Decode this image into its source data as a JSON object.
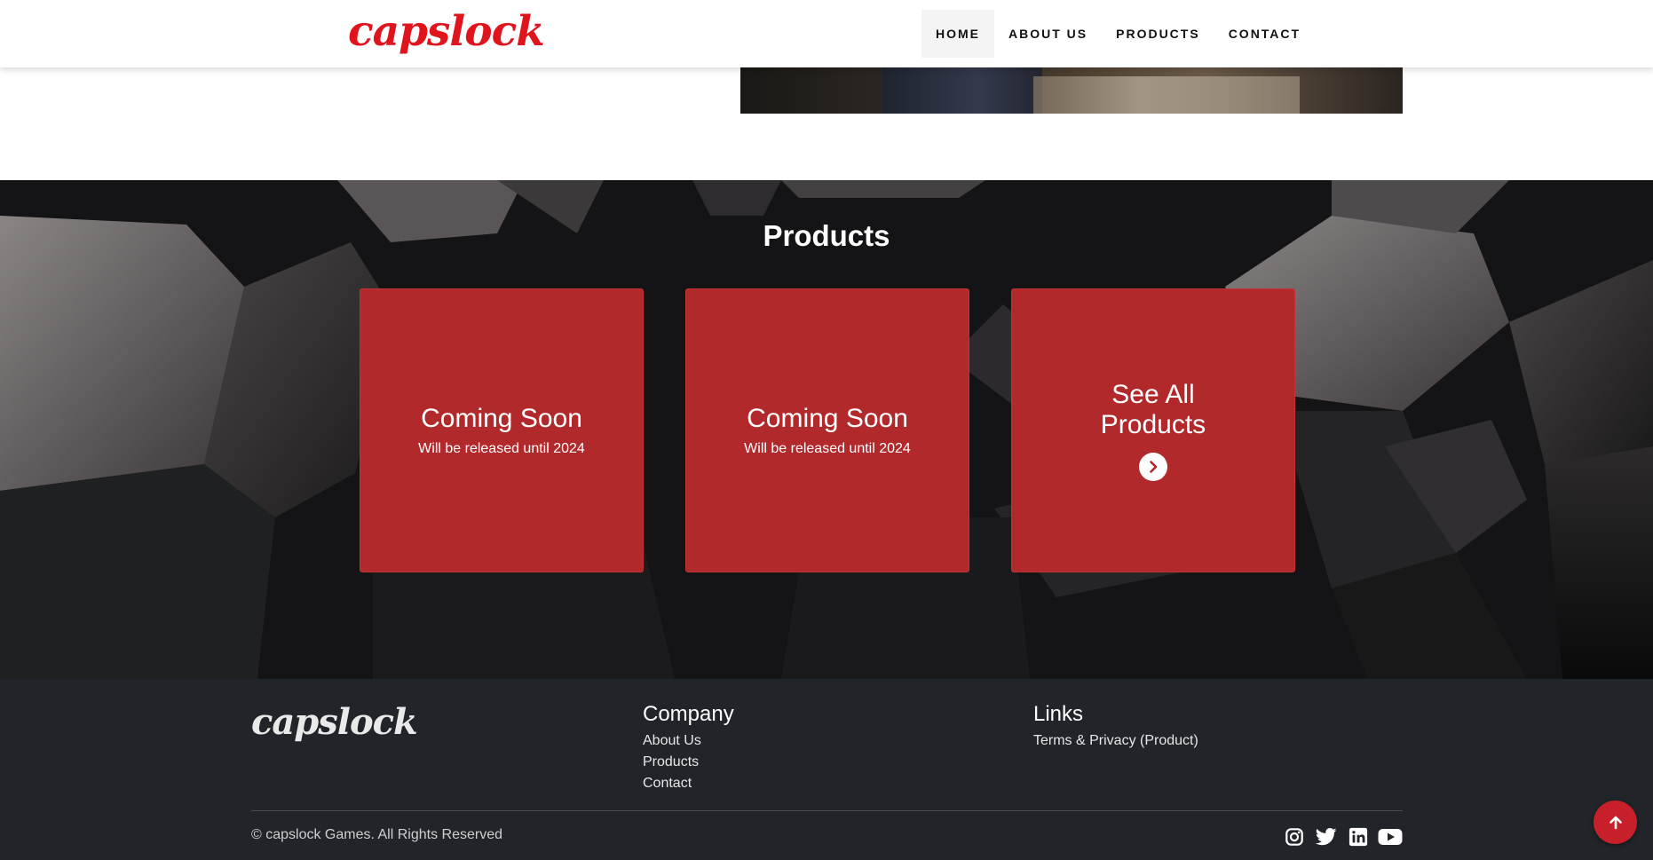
{
  "header": {
    "brand": "capslock",
    "nav": [
      {
        "label": "HOME",
        "active": true
      },
      {
        "label": "ABOUT US",
        "active": false
      },
      {
        "label": "PRODUCTS",
        "active": false
      },
      {
        "label": "CONTACT",
        "active": false
      }
    ]
  },
  "products": {
    "title": "Products",
    "cards": [
      {
        "title": "Coming Soon",
        "subtitle": "Will be released until 2024"
      },
      {
        "title": "Coming Soon",
        "subtitle": "Will be released until 2024"
      }
    ],
    "see_all": {
      "title": "See All Products",
      "icon": "chevron-right-icon"
    }
  },
  "footer": {
    "brand": "capslock",
    "company": {
      "heading": "Company",
      "links": [
        "About Us",
        "Products",
        "Contact"
      ]
    },
    "links": {
      "heading": "Links",
      "items": [
        "Terms & Privacy (Product)"
      ]
    },
    "copyright": "© capslock Games. All Rights Reserved",
    "socials": [
      "instagram-icon",
      "twitter-icon",
      "linkedin-icon",
      "youtube-icon"
    ]
  },
  "colors": {
    "brand_red": "#e0141c",
    "card_red": "#b2292c",
    "footer_bg": "#212529",
    "back_to_top": "#c8202a"
  }
}
